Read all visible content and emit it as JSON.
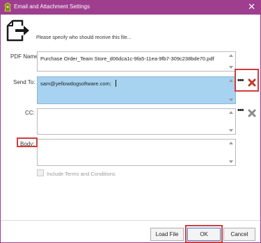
{
  "window": {
    "title": "Email and Attachment Settings",
    "close_glyph": "✕",
    "accent_color": "#9f3e8f"
  },
  "header": {
    "icon": "export-document-icon",
    "prompt": "Please specify who should receive this file..."
  },
  "form": {
    "pdf_name": {
      "label": "PDF Name:",
      "value": "Purchase Order_Team Store_d06dca1c-9fa5-11ea-9fb7-309c238bde70.pdf"
    },
    "send_to": {
      "label": "Send To:",
      "value": "sam@yellowdogsoftware.com;",
      "more_glyph": "•••",
      "remove_icon": "red-x-icon"
    },
    "cc": {
      "label": "CC:",
      "value": "",
      "more_glyph": "•••",
      "remove_icon": "gray-x-icon"
    },
    "body": {
      "label": "Body:",
      "value": ""
    },
    "include_terms": {
      "label": "Include Terms and Conditions",
      "checked": false,
      "enabled": false
    }
  },
  "buttons": {
    "load_file": "Load File",
    "ok": "OK",
    "cancel": "Cancel"
  },
  "colors": {
    "highlight": "#d33b3b",
    "selection": "#a7d3f0",
    "remove_active": "#c0392b",
    "remove_inactive": "#8a8a8a"
  }
}
